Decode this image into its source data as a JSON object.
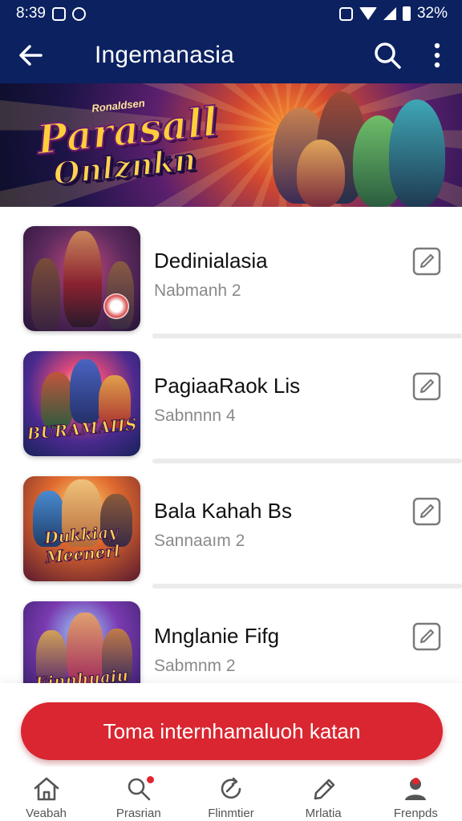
{
  "status_bar": {
    "time": "8:39",
    "battery": "32%"
  },
  "app_bar": {
    "title": "Ingemanasia"
  },
  "banner": {
    "logo_small": "Ronaldsen",
    "logo_main": "Parasall",
    "logo_sub": "Onlznkn"
  },
  "list": {
    "items": [
      {
        "title": "Dedinialasia",
        "subtitle": "Nabmanh 2",
        "thumb_text": ""
      },
      {
        "title": "PagiaaRaok Lis",
        "subtitle": "Sabnnnn 4",
        "thumb_text": "BURAMAIIS"
      },
      {
        "title": "Bala Kahah Bs",
        "subtitle": "Sannaaım 2",
        "thumb_text": "Dukkiay Meenerl"
      },
      {
        "title": "Mnglanie Fifg",
        "subtitle": "Sabmnm 2",
        "thumb_text": "Einnhuaiu"
      }
    ]
  },
  "cta": {
    "label": "Toma internhamaluoh katan"
  },
  "bottom_nav": {
    "items": [
      {
        "label": "Veabah",
        "icon": "home-icon"
      },
      {
        "label": "Prasrian",
        "icon": "search-icon"
      },
      {
        "label": "Flinmtier",
        "icon": "refresh-icon"
      },
      {
        "label": "Mrlatia",
        "icon": "pencil-icon"
      },
      {
        "label": "Frenpds",
        "icon": "profile-icon"
      }
    ]
  },
  "colors": {
    "app_bar": "#0b2160",
    "cta": "#d92630",
    "accent_dot": "#e02630"
  }
}
